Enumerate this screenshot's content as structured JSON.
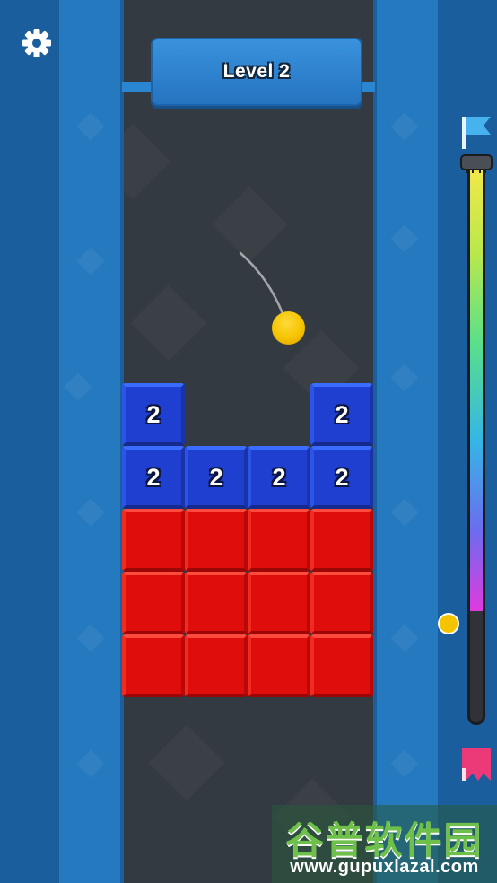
{
  "hud": {
    "level_label": "Level 2",
    "settings_icon": "gear-icon"
  },
  "board": {
    "columns": 4,
    "blue_rows": [
      [
        "2",
        "",
        "",
        "2"
      ],
      [
        "2",
        "2",
        "2",
        "2"
      ]
    ],
    "red_rows": 3
  },
  "progress": {
    "start_icon": "blue-flag-icon",
    "end_icon": "pink-flag-icon",
    "fraction_remaining": 0.8
  },
  "watermark": {
    "title": "谷普软件园",
    "url": "www.gupuxlazal.com"
  },
  "colors": {
    "blue_block": "#1e3fd0",
    "red_block": "#e00d0d",
    "ball": "#f5c400",
    "field": "#343a41",
    "rail": "#2479bf"
  }
}
